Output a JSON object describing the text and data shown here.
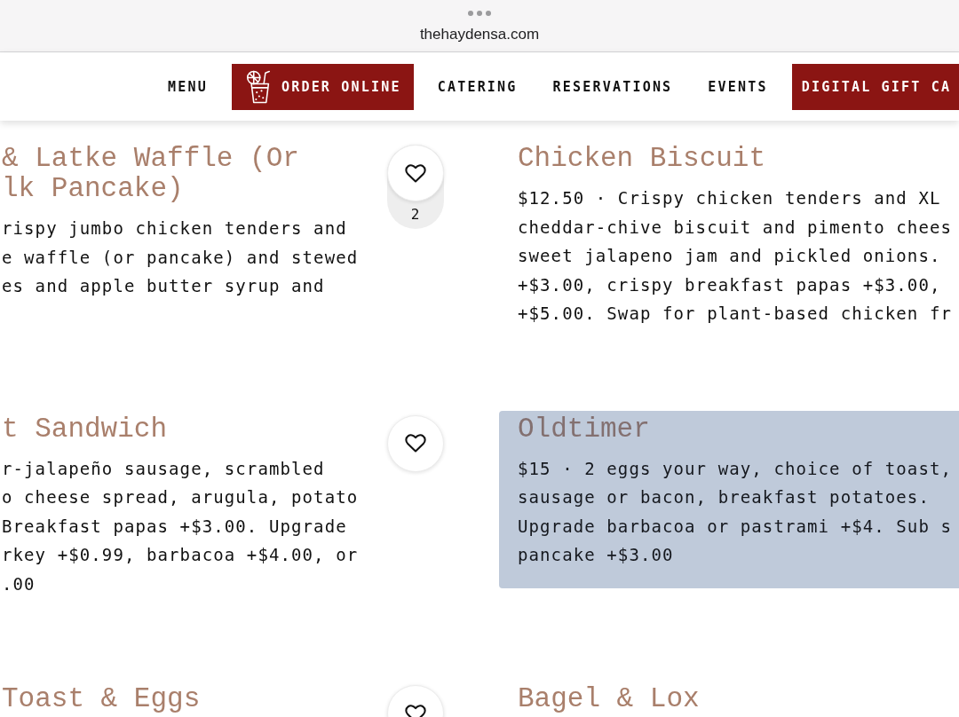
{
  "browser_bar": {
    "url": "thehaydensa.com"
  },
  "nav": {
    "items": [
      {
        "label": "MENU",
        "kind": "link"
      },
      {
        "label": "ORDER ONLINE",
        "kind": "icon-button"
      },
      {
        "label": "CATERING",
        "kind": "link"
      },
      {
        "label": "RESERVATIONS",
        "kind": "link"
      },
      {
        "label": "EVENTS",
        "kind": "link"
      },
      {
        "label": "DIGITAL GIFT CA",
        "kind": "button"
      }
    ]
  },
  "menu_rows": [
    {
      "left": {
        "title_lines": [
          "& Latke Waffle (Or",
          "lk Pancake)"
        ],
        "description_lines": [
          "rispy jumbo chicken tenders and",
          "e waffle (or pancake) and stewed",
          "es and apple butter syrup and"
        ],
        "highlighted": false
      },
      "favorite_count": "2",
      "right": {
        "title_lines": [
          "Chicken Biscuit"
        ],
        "description_lines": [
          "$12.50 · Crispy chicken tenders and XL",
          "cheddar-chive biscuit and pimento chees",
          "sweet jalapeno jam and pickled onions.",
          "+$3.00, crispy breakfast papas +$3.00,",
          "+$5.00. Swap for plant-based chicken fr"
        ],
        "highlighted": false
      }
    },
    {
      "left": {
        "title_lines": [
          "t Sandwich"
        ],
        "description_lines": [
          "r-jalapeño sausage, scrambled",
          "o cheese spread, arugula, potato",
          "Breakfast papas +$3.00. Upgrade",
          "rkey +$0.99, barbacoa +$4.00, or",
          ".00"
        ],
        "highlighted": false
      },
      "right": {
        "title_lines": [
          "Oldtimer"
        ],
        "description_lines": [
          "$15 · 2 eggs your way, choice of toast,",
          "sausage or bacon, breakfast potatoes.",
          "Upgrade barbacoa or pastrami +$4. Sub s",
          "pancake +$3.00"
        ],
        "highlighted": true
      }
    },
    {
      "left": {
        "title_lines": [
          "Toast & Eggs"
        ],
        "highlighted": false
      },
      "right": {
        "title_lines": [
          "Bagel & Lox"
        ],
        "highlighted": false
      }
    }
  ]
}
